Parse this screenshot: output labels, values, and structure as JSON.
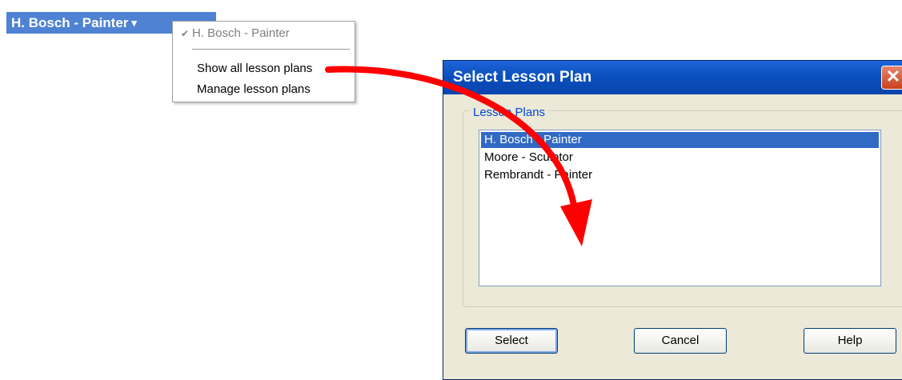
{
  "lesson_plan_selector": {
    "label": "H. Bosch - Painter",
    "chevron_icon": "chevron-down-icon"
  },
  "menu": {
    "checked_item": "H. Bosch - Painter",
    "items": [
      "Show all lesson plans",
      "Manage lesson plans"
    ]
  },
  "dialog": {
    "title": "Select Lesson Plan",
    "group_label": "Lesson Plans",
    "list_items": [
      "H. Bosch - Painter",
      "Moore - Sculptor",
      "Rembrandt - Painter"
    ],
    "selected_index": 0,
    "buttons": {
      "select": "Select",
      "cancel": "Cancel",
      "help": "Help"
    },
    "close_glyph": "✕"
  },
  "colors": {
    "accent": "#4f82d3",
    "selection": "#316ac5",
    "title_bar": "#0a4ebc",
    "arrow": "#ff0000"
  }
}
